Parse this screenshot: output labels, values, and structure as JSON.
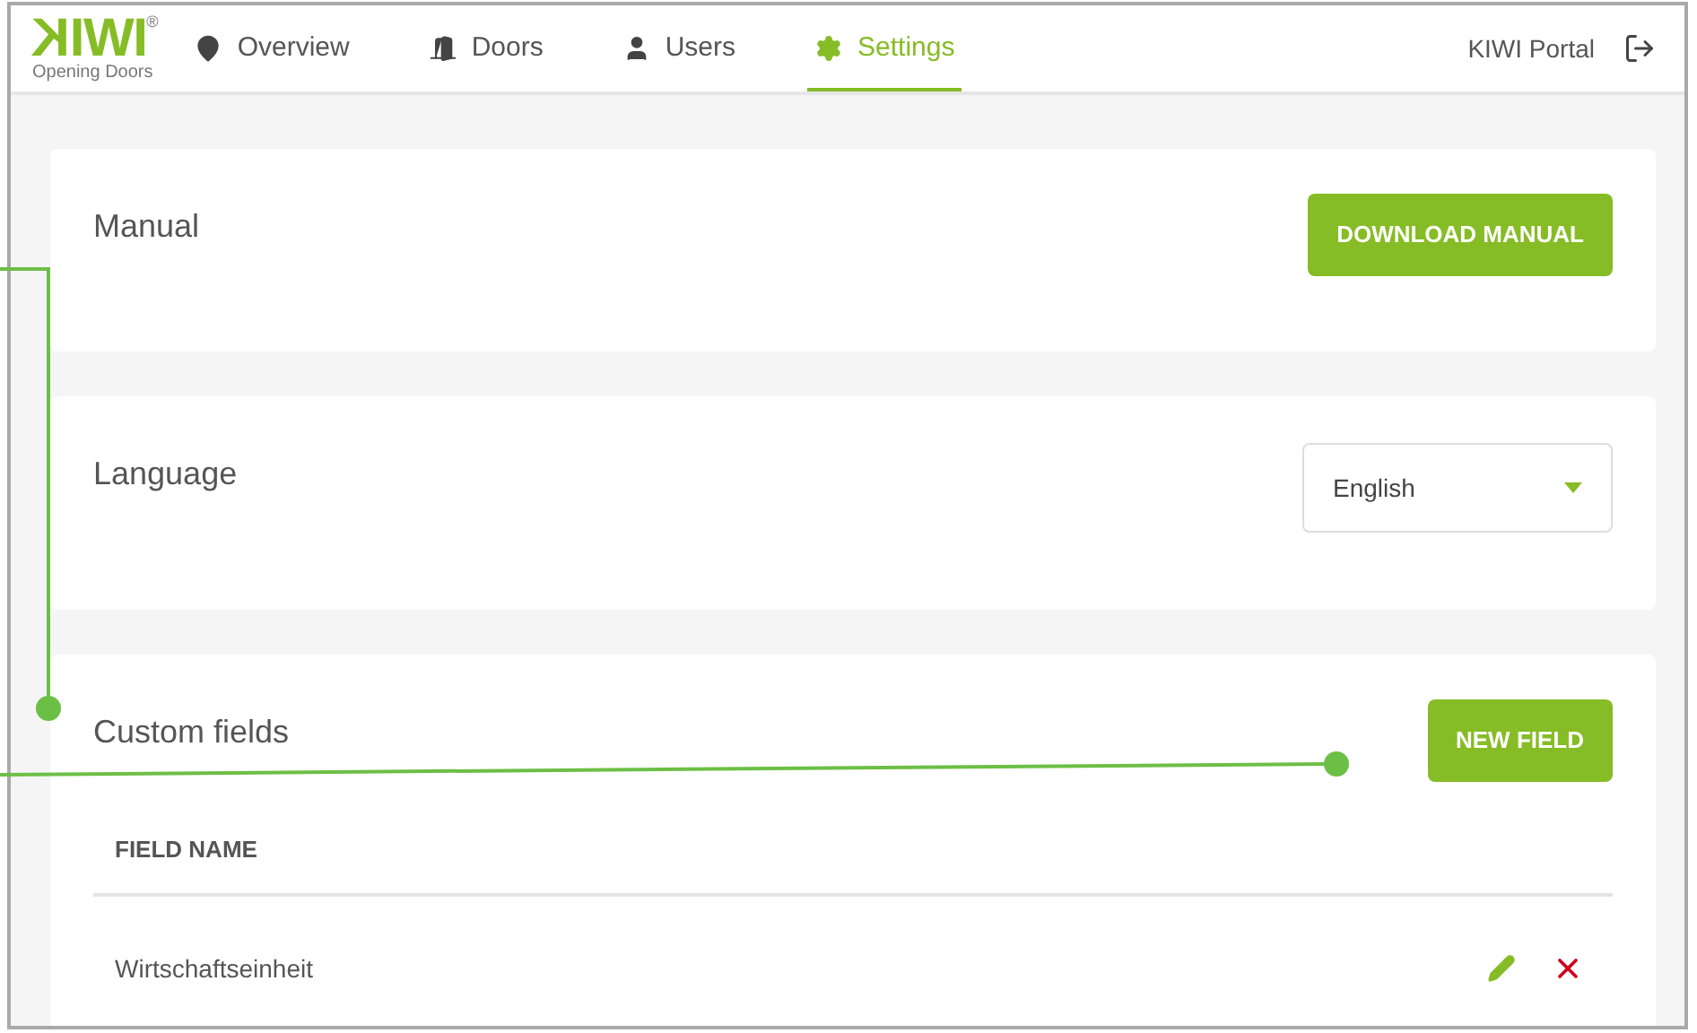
{
  "logo": {
    "wordmark": "KIWI",
    "registered": "®",
    "tagline": "Opening Doors"
  },
  "nav": [
    {
      "label": "Overview",
      "kind": "pin",
      "selected": false
    },
    {
      "label": "Doors",
      "kind": "door",
      "selected": false
    },
    {
      "label": "Users",
      "kind": "user",
      "selected": false
    },
    {
      "label": "Settings",
      "kind": "gear",
      "selected": true
    }
  ],
  "portal": {
    "label": "KIWI Portal"
  },
  "manual": {
    "title": "Manual",
    "button": "DOWNLOAD MANUAL"
  },
  "language": {
    "title": "Language",
    "value": "English"
  },
  "custom_fields": {
    "title": "Custom fields",
    "button": "NEW FIELD",
    "table": {
      "columns": [
        "FIELD NAME"
      ],
      "rows": [
        {
          "name": "Wirtschaftseinheit"
        }
      ]
    }
  }
}
